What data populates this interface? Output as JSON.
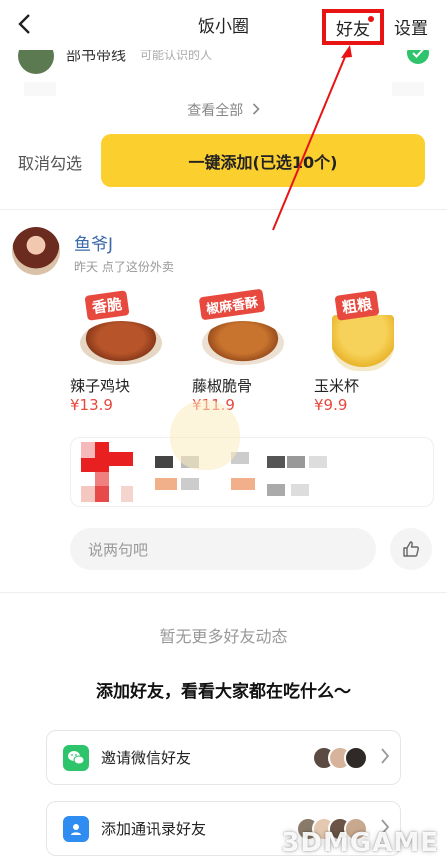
{
  "header": {
    "title": "饭小圈",
    "tab_friends": "好友",
    "tab_settings": "设置"
  },
  "recommend": {
    "partial_name": "部书带线",
    "partial_hint": "可能认识的人",
    "view_all": "查看全部",
    "cancel_select": "取消勾选",
    "add_all_button": "一键添加(已选10个)"
  },
  "feed": {
    "user_name": "鱼爷J",
    "activity": "昨天 点了这份外卖",
    "foods": [
      {
        "name": "辣子鸡块",
        "price": "¥13.9",
        "tag": "香脆"
      },
      {
        "name": "藤椒脆骨",
        "price": "¥11.9",
        "tag": "椒麻香酥"
      },
      {
        "name": "玉米杯",
        "price": "¥9.9",
        "tag": "粗粮"
      }
    ],
    "comment_placeholder": "说两句吧"
  },
  "empty": {
    "no_more": "暂无更多好友动态",
    "headline": "添加好友，看看大家都在吃什么～"
  },
  "invite": {
    "wechat_label": "邀请微信好友",
    "contacts_label": "添加通讯录好友"
  },
  "watermark": "3DMGAME",
  "colors": {
    "accent_yellow": "#fbcf2e",
    "price_red": "#e8493f",
    "name_blue": "#3b6aa8",
    "annotation_red": "#e81414",
    "wechat_green": "#2ec46b",
    "contacts_blue": "#2f8cf0"
  }
}
